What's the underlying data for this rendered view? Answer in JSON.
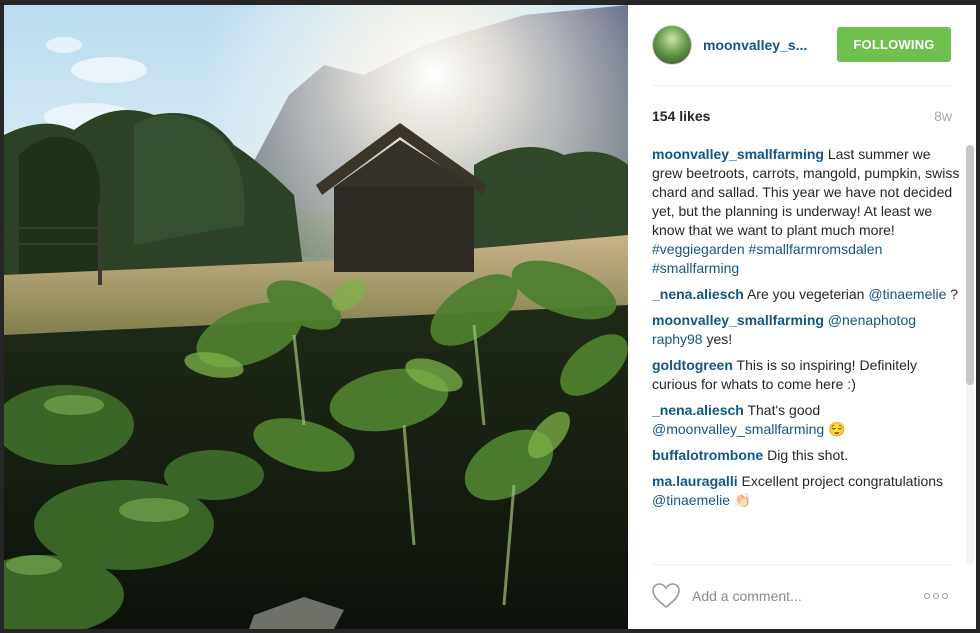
{
  "post": {
    "username": "moonvalley_s...",
    "follow_label": "FOLLOWING",
    "likes": "154 likes",
    "age": "8w",
    "comment_placeholder": "Add a comment...",
    "icons": {
      "like": "heart-icon",
      "more": "more-options-icon"
    },
    "colors": {
      "link": "#125688",
      "follow_button": "#70c050"
    },
    "caption": {
      "author": "moonvalley_smallfarming",
      "text": " Last summer we grew beetroots, carrots, mangold, pumpkin, swiss chard and sallad. This year we have not decided yet, but the planning is underway! At least we know that we want to plant much more! ",
      "tags": [
        "#veggiegarden",
        "#smallfarmromsdalen",
        "#smallfarming"
      ]
    },
    "comments": [
      {
        "author": "_nena.aliesch",
        "pre": " Are you vegeterian ",
        "mention": "@tinaemelie",
        "post": " ?"
      },
      {
        "author": "moonvalley_smallfarming",
        "pre": " ",
        "mention": "@nenaphotog raphy98",
        "post": " yes!"
      },
      {
        "author": "goldtogreen",
        "pre": " This is so inspiring! Definitely curious for whats to come here :)",
        "mention": "",
        "post": ""
      },
      {
        "author": "_nena.aliesch",
        "pre": " That's good ",
        "mention": "@moonvalley_smallfarming",
        "post": " 😌"
      },
      {
        "author": "buffalotrombone",
        "pre": " Dig this shot.",
        "mention": "",
        "post": ""
      },
      {
        "author": "ma.lauragalli",
        "pre": " Excellent project congratulations ",
        "mention": "@tinaemelie",
        "post": " 👏🏻"
      }
    ]
  }
}
